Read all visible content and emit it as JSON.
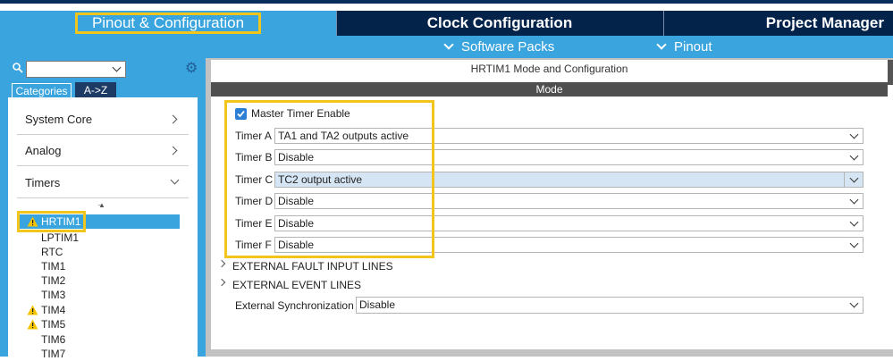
{
  "tabs": {
    "pinout": "Pinout & Configuration",
    "clock": "Clock Configuration",
    "project": "Project Manager"
  },
  "subbar": {
    "software_packs": "Software Packs",
    "pinout": "Pinout"
  },
  "left": {
    "search_value": "",
    "categories_tab": "Categories",
    "atoz_tab": "A->Z",
    "categories": [
      "System Core",
      "Analog",
      "Timers"
    ],
    "peripherals": [
      {
        "name": "HRTIM1",
        "warning": true,
        "selected": true
      },
      {
        "name": "LPTIM1",
        "warning": false
      },
      {
        "name": "RTC",
        "warning": false
      },
      {
        "name": "TIM1",
        "warning": false
      },
      {
        "name": "TIM2",
        "warning": false
      },
      {
        "name": "TIM3",
        "warning": false
      },
      {
        "name": "TIM4",
        "warning": true
      },
      {
        "name": "TIM5",
        "warning": true
      },
      {
        "name": "TIM6",
        "warning": false
      },
      {
        "name": "TIM7",
        "warning": false
      }
    ]
  },
  "main": {
    "title": "HRTIM1 Mode and Configuration",
    "mode_header": "Mode",
    "master_timer_label": "Master Timer Enable",
    "master_timer_checked": true,
    "timers": [
      {
        "label": "Timer A",
        "value": "TA1 and TA2 outputs active"
      },
      {
        "label": "Timer B",
        "value": "Disable"
      },
      {
        "label": "Timer C",
        "value": "TC2 output active"
      },
      {
        "label": "Timer D",
        "value": "Disable"
      },
      {
        "label": "Timer E",
        "value": "Disable"
      },
      {
        "label": "Timer F",
        "value": "Disable"
      }
    ],
    "sections": [
      "EXTERNAL FAULT INPUT LINES",
      "EXTERNAL EVENT LINES"
    ],
    "ext_sync_label": "External Synchronization",
    "ext_sync_value": "Disable"
  },
  "colors": {
    "accent": "#39a4de",
    "navy": "#03234b",
    "highlight": "#f2c51c",
    "warning": "#f5c400"
  }
}
